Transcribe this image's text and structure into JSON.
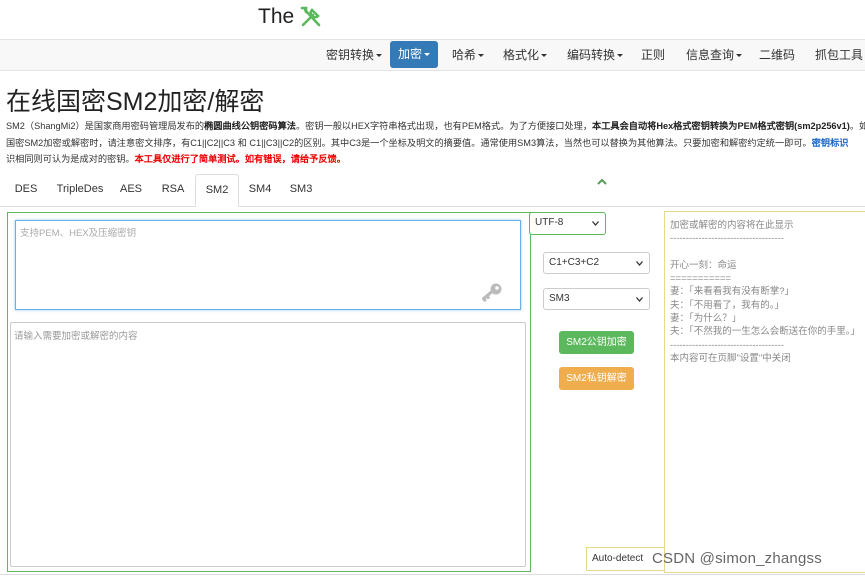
{
  "brand": {
    "text": "The",
    "logo_icon": "tools-icon",
    "logo_color": "#5cb85c"
  },
  "nav": {
    "active_color": "#337ab7",
    "items": [
      {
        "label": "密钥转换",
        "dropdown": true,
        "active": false
      },
      {
        "label": "加密",
        "dropdown": true,
        "active": true
      },
      {
        "label": "哈希",
        "dropdown": true,
        "active": false
      },
      {
        "label": "格式化",
        "dropdown": true,
        "active": false
      },
      {
        "label": "编码转换",
        "dropdown": true,
        "active": false
      },
      {
        "label": "正则",
        "dropdown": false,
        "active": false
      },
      {
        "label": "信息查询",
        "dropdown": true,
        "active": false
      },
      {
        "label": "二维码",
        "dropdown": false,
        "active": false
      },
      {
        "label": "抓包工具",
        "dropdown": false,
        "active": false
      }
    ]
  },
  "page": {
    "title": "在线国密SM2加密/解密",
    "intro_line1_a": "SM2（ShangMi2）是国家商用密码管理局发布的",
    "intro_line1_b": "椭圆曲线公钥密码算法",
    "intro_line1_c": "。密钥一般以HEX字符串格式出现，也有PEM格式。为了方便接口处理，",
    "intro_line1_d": "本工具会自动将Hex格式密钥转换为PEM格式密钥(sm2p256v1)",
    "intro_line1_e": "。如",
    "intro_line2_a": "国密SM2加密或解密时，请注意密文排序，有C1||C2||C3 和 C1||C3||C2的区别。其中C3是一个坐标及明文的摘要值。通常使用SM3算法，当然也可以替换为其他算法。只要加密和解密约定统一即可。",
    "intro_line2_b": "密钥标识",
    "intro_line3_a": "识相同则可认为是成对的密钥。",
    "intro_line3_b": "本工具仅进行了简单测试。如有错误，请给予反馈。"
  },
  "tabs": [
    {
      "label": "DES",
      "active": false
    },
    {
      "label": "TripleDes",
      "active": false
    },
    {
      "label": "AES",
      "active": false
    },
    {
      "label": "RSA",
      "active": false
    },
    {
      "label": "SM2",
      "active": true
    },
    {
      "label": "SM4",
      "active": false
    },
    {
      "label": "SM3",
      "active": false
    }
  ],
  "form": {
    "key_placeholder": "支持PEM、HEX及压缩密钥",
    "content_placeholder": "请输入需要加密或解密的内容",
    "encoding_value": "UTF-8",
    "mode_value": "C1+C3+C2",
    "hash_value": "SM3",
    "encrypt_label": "SM2公钥加密",
    "decrypt_label": "SM2私钥解密",
    "encrypt_color": "#5cb85c",
    "decrypt_color": "#f0ad4e",
    "autodetect_label": "Auto-detect"
  },
  "output": {
    "text": "加密或解密的内容将在此显示\n------------------------------------\n\n开心一刻：命运\n===========\n妻：「来看看我有没有断掌?」\n夫：「不用看了，我有的。」\n妻：「为什么？」\n夫：「不然我的一生怎么会断送在你的手里。」\n------------------------------------\n本内容可在页脚\"设置\"中关闭"
  },
  "watermark": "CSDN @simon_zhangss"
}
